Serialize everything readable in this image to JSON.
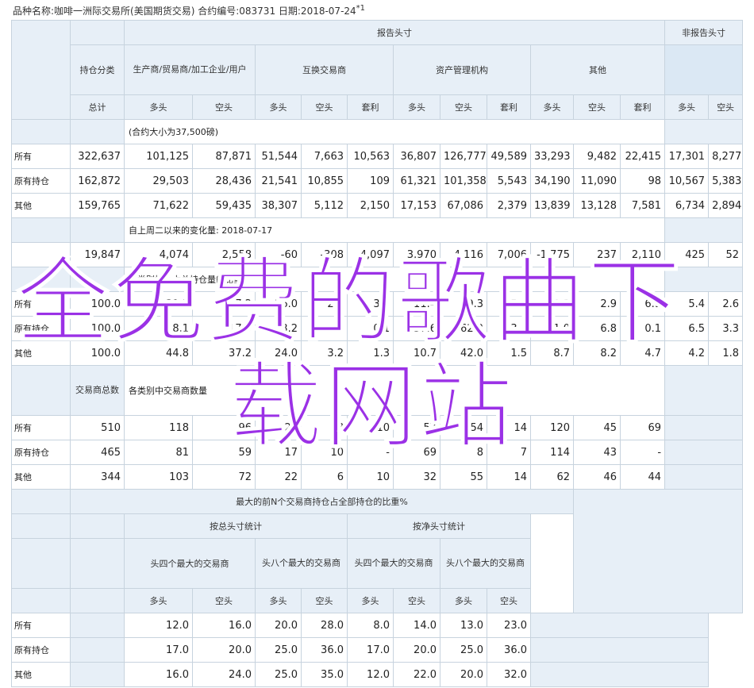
{
  "header": {
    "text": "品种名称:咖啡一洲际交易所(美国期货交易)   合约编号:083731   日期:2018-07-24",
    "sup": "*1"
  },
  "section1": {
    "report": "报告头寸",
    "nonreport": "非报告头寸",
    "holdcat": "持仓分类",
    "producer": "生产商/贸易商/加工企业/用户",
    "swap": "互换交易商",
    "asset": "资产管理机构",
    "other": "其他",
    "total": "总计",
    "long": "多头",
    "short": "空头",
    "spread": "套利",
    "note": "(合约大小为37,500磅)",
    "rows": [
      {
        "label": "所有",
        "v": [
          "322,637",
          "101,125",
          "87,871",
          "51,544",
          "7,663",
          "10,563",
          "36,807",
          "126,777",
          "49,589",
          "33,293",
          "9,482",
          "22,415",
          "17,301",
          "8,277"
        ]
      },
      {
        "label": "原有持仓",
        "v": [
          "162,872",
          "29,503",
          "28,436",
          "21,541",
          "10,855",
          "109",
          "61,321",
          "101,358",
          "5,543",
          "34,190",
          "11,090",
          "98",
          "10,567",
          "5,383"
        ]
      },
      {
        "label": "其他",
        "v": [
          "159,765",
          "71,622",
          "59,435",
          "38,307",
          "5,112",
          "2,150",
          "17,153",
          "67,086",
          "2,379",
          "13,839",
          "13,128",
          "7,581",
          "6,734",
          "2,894"
        ]
      }
    ]
  },
  "section2": {
    "note": "自上周二以来的变化量: 2018-07-17",
    "values": [
      "19,847",
      "4,074",
      "2,558",
      "-60",
      "-308",
      "4,097",
      "3,970",
      "4,116",
      "7,006",
      "-1,775",
      "237",
      "2,110",
      "425",
      "52"
    ]
  },
  "section3": {
    "note": "各类别持仓占总持仓量的比重",
    "rows": [
      {
        "label": "所有",
        "v": [
          "100.0",
          "31.3",
          "27.2",
          "16.0",
          "2.4",
          "3.3",
          "11.4",
          "39.3",
          "15.4",
          "10.3",
          "2.9",
          "6.9",
          "5.4",
          "2.6"
        ]
      },
      {
        "label": "原有持仓",
        "v": [
          "100.0",
          "18.1",
          "17.5",
          "13.2",
          "6.7",
          "0.1",
          "37.6",
          "62.2",
          "3.4",
          "21.0",
          "6.8",
          "0.1",
          "6.5",
          "3.3"
        ]
      },
      {
        "label": "其他",
        "v": [
          "100.0",
          "44.8",
          "37.2",
          "24.0",
          "3.2",
          "1.3",
          "10.7",
          "42.0",
          "1.5",
          "8.7",
          "8.2",
          "4.7",
          "4.2",
          "1.8"
        ]
      }
    ]
  },
  "section4": {
    "total_traders": "交易商总数",
    "note": "各类别中交易商数量",
    "rows": [
      {
        "label": "所有",
        "v": [
          "510",
          "118",
          "96",
          "22",
          "8",
          "10",
          "57",
          "54",
          "14",
          "120",
          "45",
          "69",
          "",
          ""
        ]
      },
      {
        "label": "原有持仓",
        "v": [
          "465",
          "81",
          "59",
          "17",
          "10",
          "-",
          "69",
          "8",
          "7",
          "114",
          "43",
          "-",
          "",
          ""
        ]
      },
      {
        "label": "其他",
        "v": [
          "344",
          "103",
          "72",
          "22",
          "6",
          "10",
          "32",
          "55",
          "14",
          "62",
          "46",
          "44",
          "",
          ""
        ]
      }
    ]
  },
  "section5": {
    "title": "最大的前N个交易商持仓占全部持仓的比重%",
    "gross": "按总头寸统计",
    "net": "按净头寸统计",
    "top4": "头四个最大的交易商",
    "top8": "头八个最大的交易商",
    "long": "多头",
    "short": "空头",
    "rows": [
      {
        "label": "所有",
        "v": [
          "12.0",
          "16.0",
          "20.0",
          "28.0",
          "8.0",
          "14.0",
          "13.0",
          "23.0"
        ]
      },
      {
        "label": "原有持仓",
        "v": [
          "17.0",
          "20.0",
          "25.0",
          "36.0",
          "17.0",
          "20.0",
          "25.0",
          "36.0"
        ]
      },
      {
        "label": "其他",
        "v": [
          "16.0",
          "24.0",
          "25.0",
          "35.0",
          "12.0",
          "22.0",
          "20.0",
          "32.0"
        ]
      }
    ]
  },
  "watermark": {
    "line1": "全免费的歌曲下",
    "line2": "载网站"
  }
}
